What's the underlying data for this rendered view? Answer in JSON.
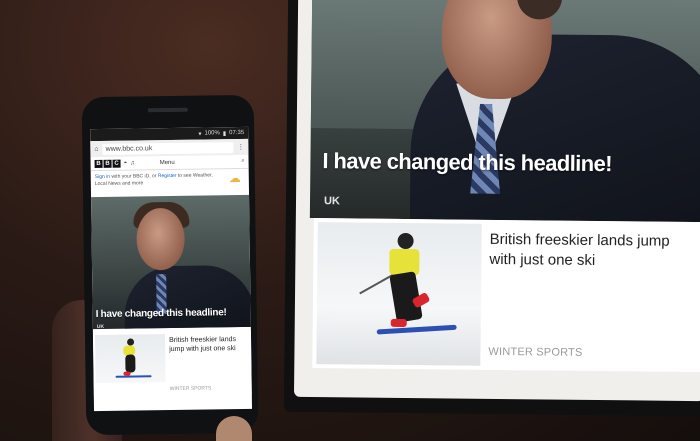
{
  "phone": {
    "status": {
      "battery": "100%",
      "time": "07:35"
    },
    "browser": {
      "url": "www.bbc.co.uk"
    },
    "bbc_header": {
      "logo_letters": [
        "B",
        "B",
        "C"
      ],
      "menu_label": "Menu"
    },
    "signin": {
      "link_signin": "Sign in",
      "text_mid": " with your BBC iD, or ",
      "link_register": "Register",
      "text_end": " to see Weather, Local News and more"
    },
    "hero": {
      "headline": "I have changed this headline!",
      "tag": "UK"
    },
    "story": {
      "title": "British freeskier lands jump with just one ski",
      "tag": "WINTER SPORTS"
    }
  },
  "monitor": {
    "hero": {
      "headline": "I have changed this headline!",
      "tag": "UK"
    },
    "story": {
      "title": "British freeskier lands jump with just one ski",
      "tag": "WINTER SPORTS"
    }
  },
  "colors": {
    "link_blue": "#1a64c4",
    "ski_blue": "#2b4fb3",
    "vest_yellow": "#e7e23a",
    "boot_red": "#d8262d"
  }
}
